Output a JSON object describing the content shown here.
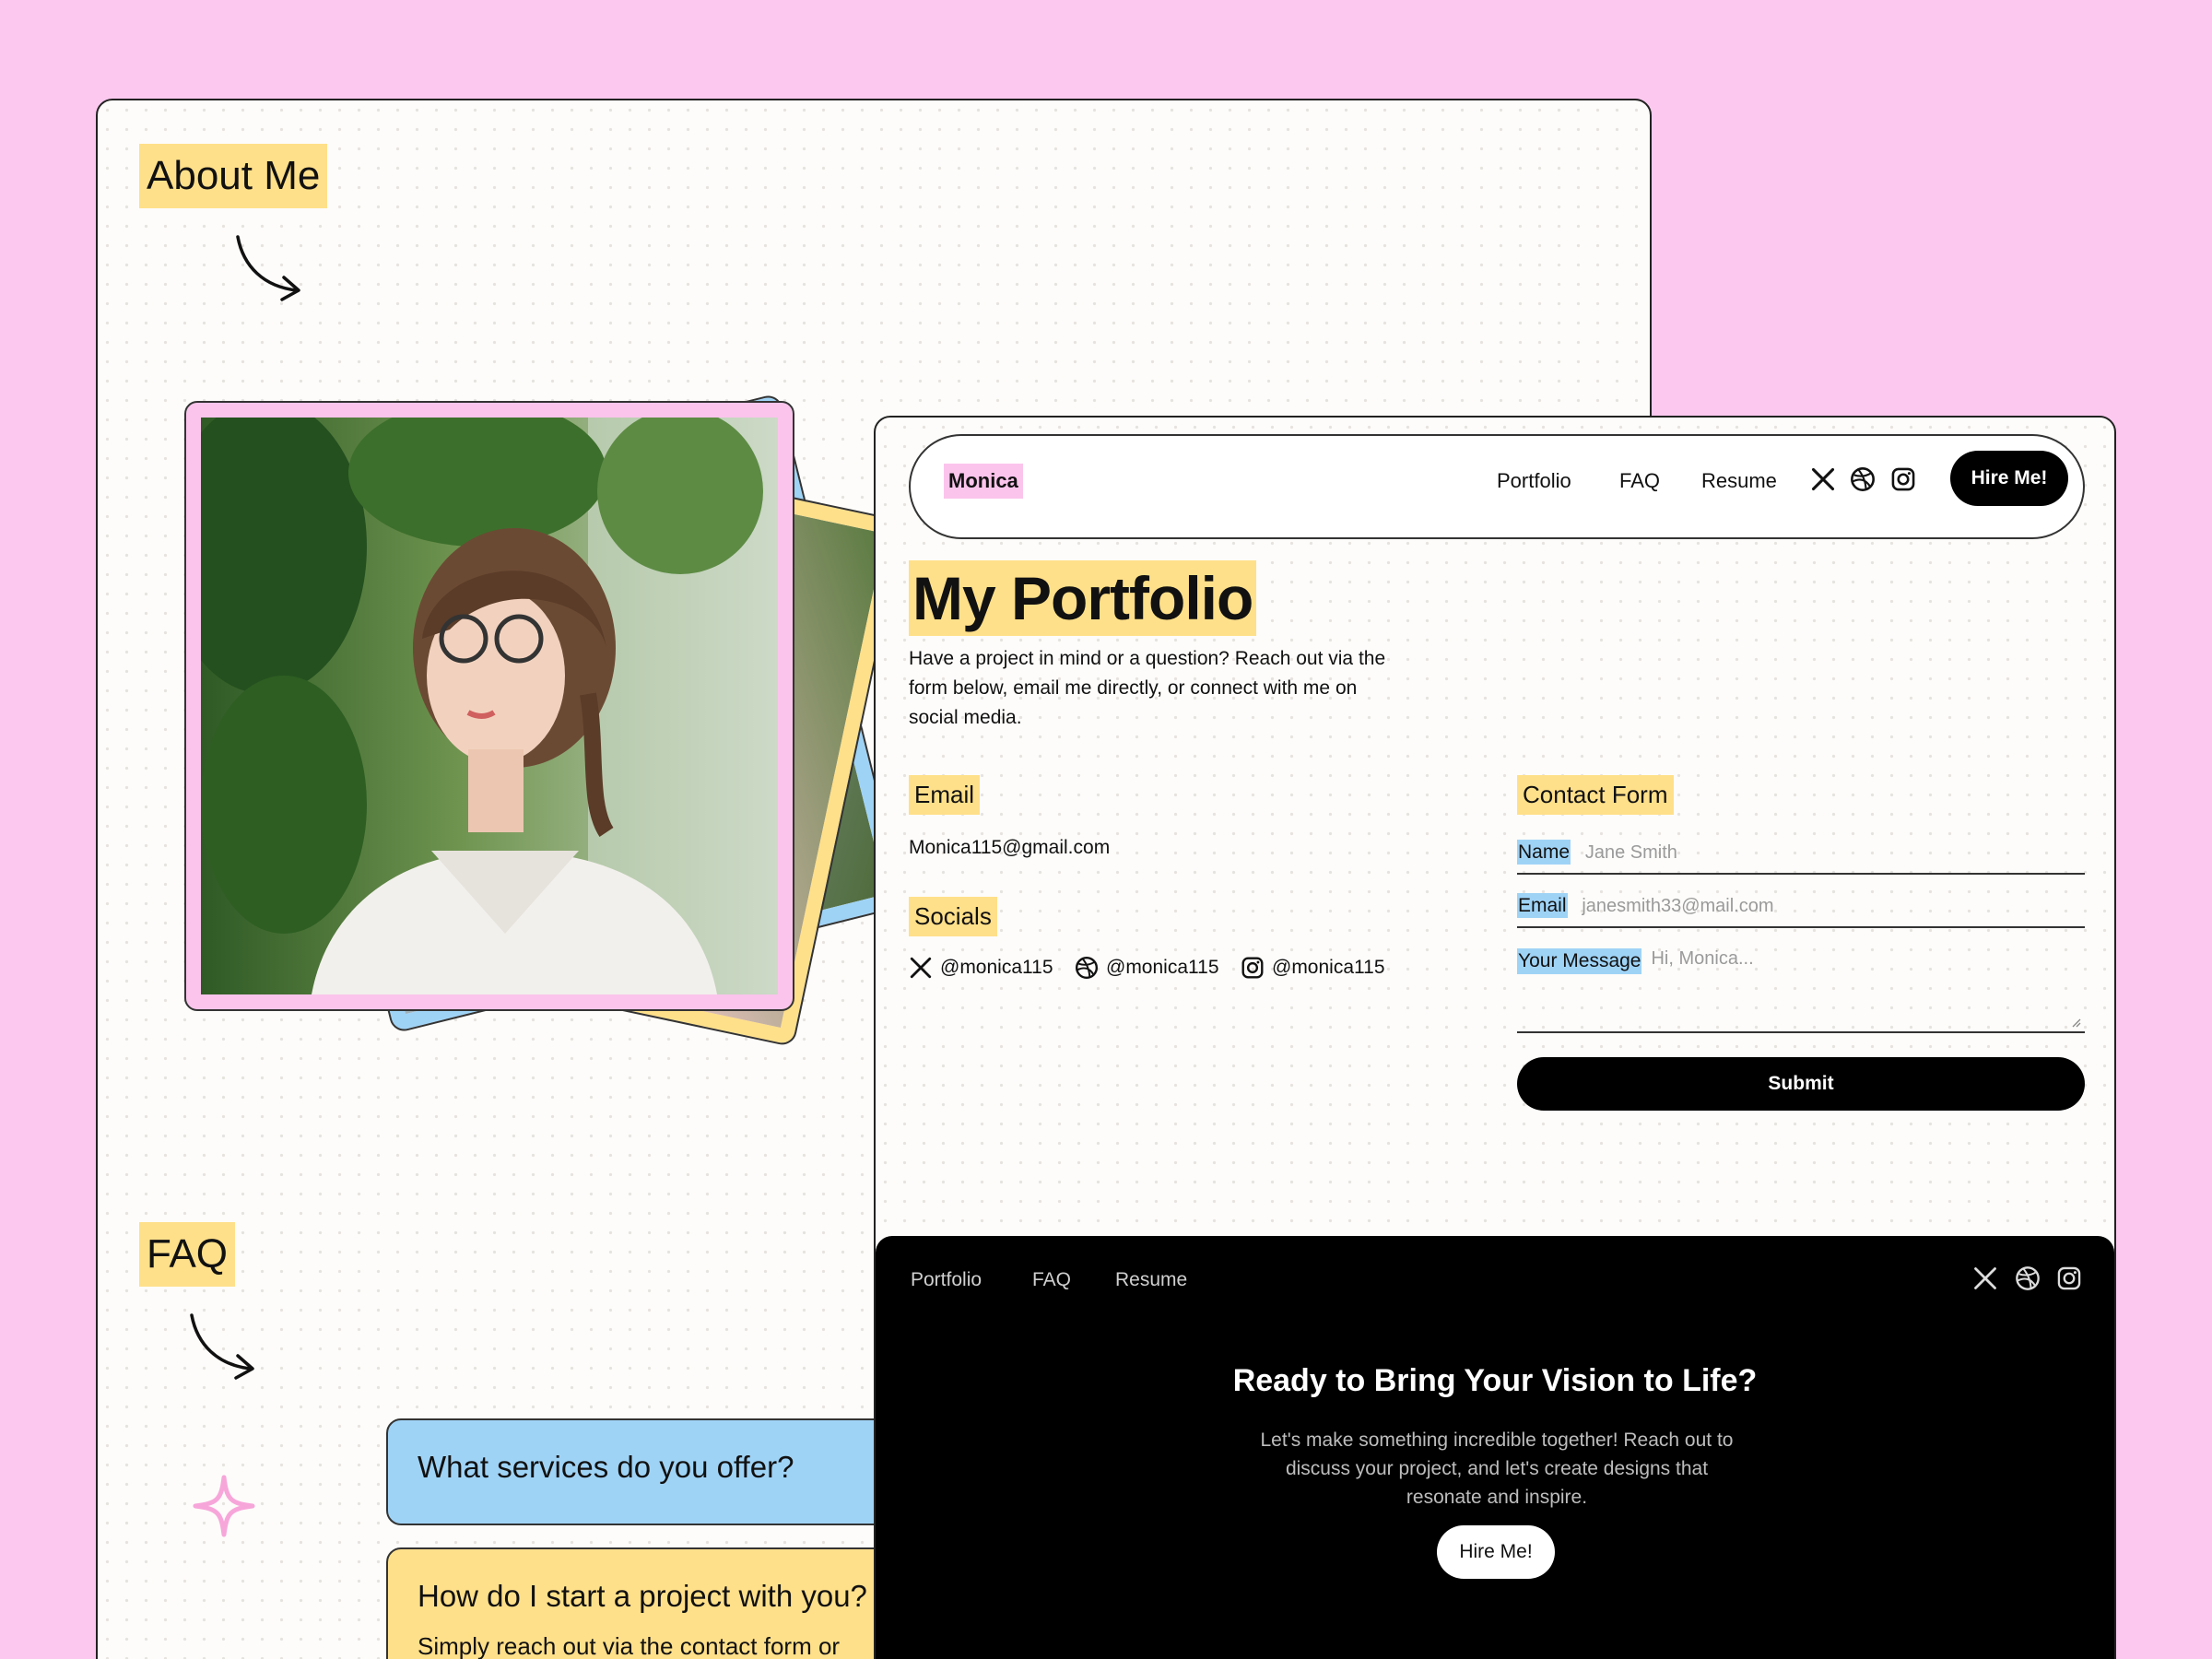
{
  "about": {
    "title": "About Me",
    "faq_title": "FAQ",
    "faq": [
      {
        "question": "What services do you offer?"
      },
      {
        "question": "How do I start a project with you?",
        "answer": "Simply reach out via the contact form or"
      }
    ]
  },
  "portfolio": {
    "nav": {
      "brand": "Monica",
      "links": [
        "Portfolio",
        "FAQ",
        "Resume"
      ],
      "icons": [
        "x-icon",
        "dribbble-icon",
        "instagram-icon"
      ],
      "hire_label": "Hire Me!"
    },
    "title": "My Portfolio",
    "intro": "Have a project in mind or a question? Reach out via the form below, email me directly, or connect with me on social media.",
    "email_heading": "Email",
    "email": "Monica115@gmail.com",
    "socials_heading": "Socials",
    "socials": [
      {
        "icon": "x-icon",
        "handle": "@monica115"
      },
      {
        "icon": "dribbble-icon",
        "handle": "@monica115"
      },
      {
        "icon": "instagram-icon",
        "handle": "@monica115"
      }
    ],
    "contact_form": {
      "heading": "Contact Form",
      "name_label": "Name",
      "name_placeholder": "Jane Smith",
      "email_label": "Email",
      "email_placeholder": "janesmith33@mail.com",
      "message_label": "Your Message",
      "message_placeholder": "Hi, Monica...",
      "submit_label": "Submit"
    },
    "footer": {
      "links": [
        "Portfolio",
        "FAQ",
        "Resume"
      ],
      "cta_title": "Ready to Bring Your Vision to Life?",
      "cta_text": "Let's make something incredible together! Reach out to discuss your project, and let's create designs that resonate and inspire.",
      "hire_label": "Hire Me!"
    }
  },
  "colors": {
    "background": "#fcc8ef",
    "highlight_yellow": "#ffe08a",
    "highlight_blue": "#9fd3f6",
    "highlight_pink": "#fbc4ec",
    "dark": "#000000"
  }
}
